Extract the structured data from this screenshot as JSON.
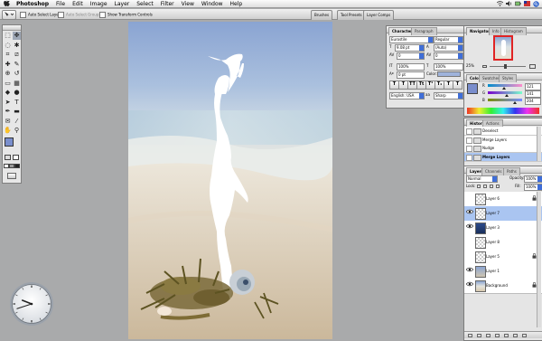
{
  "menubar": {
    "apple": "",
    "app_name": "Photoshop",
    "menus": [
      "File",
      "Edit",
      "Image",
      "Layer",
      "Select",
      "Filter",
      "View",
      "Window",
      "Help"
    ]
  },
  "options_bar": {
    "auto_select_layer": "Auto Select Layer",
    "auto_select_groups": "Auto Select Groups",
    "show_transform_controls": "Show Transform Controls",
    "palette_well": [
      "Brushes",
      "Tool Presets",
      "Layer Comps"
    ]
  },
  "character_panel": {
    "tabs": [
      "Character",
      "Paragraph"
    ],
    "font_family": "Eurostile",
    "font_style": "Regular",
    "font_size": "9.08 pt",
    "leading": "(Auto)",
    "kerning": "0",
    "tracking": "0",
    "vertical_scale": "100%",
    "horizontal_scale": "100%",
    "baseline_shift": "0 pt",
    "color_label": "Color:",
    "style_buttons": [
      "T",
      "T",
      "TT",
      "Tt",
      "T¹",
      "T₁",
      "T",
      "T"
    ],
    "language": "English: USA",
    "antialias": "Sharp",
    "swatch_color": "#9fb3db"
  },
  "navigator_panel": {
    "tabs": [
      "Navigator",
      "Info",
      "Histogram"
    ],
    "zoom": "25%"
  },
  "color_panel": {
    "tabs": [
      "Color",
      "Swatches",
      "Styles"
    ],
    "channels": [
      {
        "label": "R",
        "value": "121",
        "fraction": 0.47
      },
      {
        "label": "G",
        "value": "141",
        "fraction": 0.55
      },
      {
        "label": "B",
        "value": "204",
        "fraction": 0.8
      }
    ],
    "foreground": "#798dcc"
  },
  "history_panel": {
    "tabs": [
      "History",
      "Actions"
    ],
    "items": [
      {
        "label": "Deselect",
        "selected": false
      },
      {
        "label": "Merge Layers",
        "selected": false
      },
      {
        "label": "Nudge",
        "selected": false
      },
      {
        "label": "Merge Layers",
        "selected": true
      }
    ]
  },
  "layers_panel": {
    "tabs": [
      "Layers",
      "Channels",
      "Paths"
    ],
    "blend_mode": "Normal",
    "opacity_label": "Opacity:",
    "opacity": "100%",
    "lock_label": "Lock:",
    "fill_label": "Fill:",
    "fill": "100%",
    "layers": [
      {
        "name": "Layer 6",
        "visible": false,
        "selected": false,
        "locked": true
      },
      {
        "name": "Layer 7",
        "visible": true,
        "selected": true,
        "locked": false
      },
      {
        "name": "Layer 3",
        "visible": true,
        "selected": false,
        "locked": false
      },
      {
        "name": "Layer 8",
        "visible": false,
        "selected": false,
        "locked": false
      },
      {
        "name": "Layer 5",
        "visible": false,
        "selected": false,
        "locked": true
      },
      {
        "name": "Layer 1",
        "visible": true,
        "selected": false,
        "locked": false
      },
      {
        "name": "Background",
        "visible": true,
        "selected": false,
        "locked": true
      }
    ]
  },
  "clock": {
    "hours": 9,
    "minutes": 42
  },
  "toolbox": {
    "foreground_color": "#7a8fcd",
    "background_color": "#ffffff"
  }
}
